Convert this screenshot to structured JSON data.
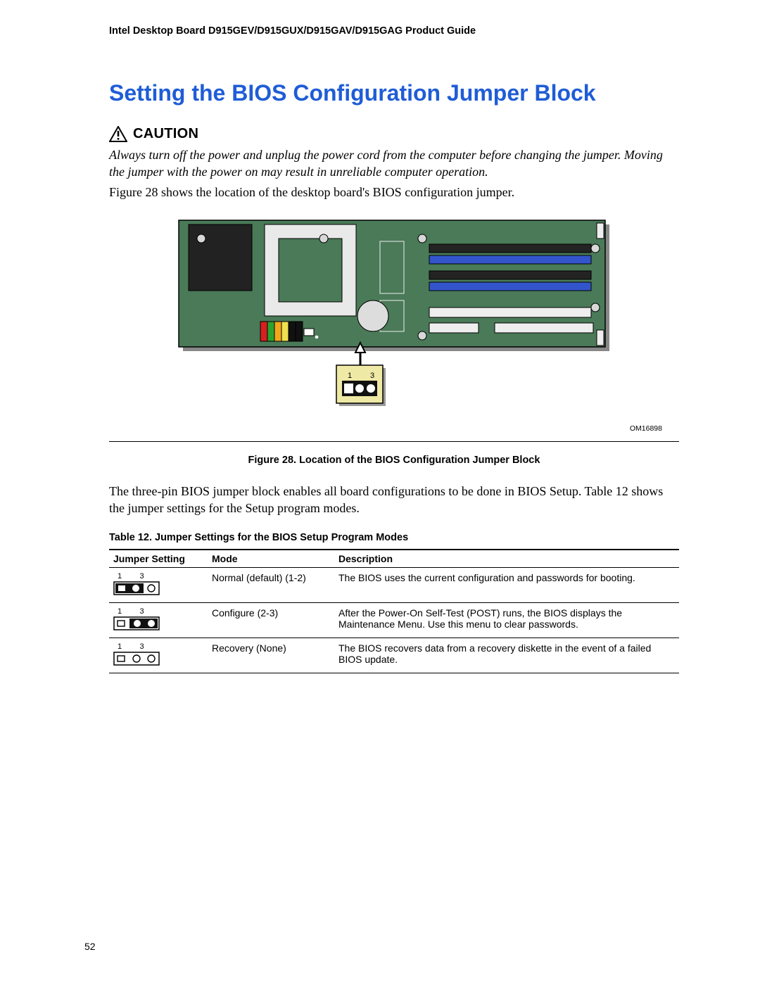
{
  "header": "Intel Desktop Board D915GEV/D915GUX/D915GAV/D915GAG Product Guide",
  "title": "Setting the BIOS Configuration Jumper Block",
  "caution_label": "CAUTION",
  "caution_text": "Always turn off the power and unplug the power cord from the computer before changing the jumper.  Moving the jumper with the power on may result in unreliable computer operation.",
  "intro_text": "Figure 28 shows the location of the desktop board's BIOS configuration jumper.",
  "figure": {
    "callout_pins": {
      "left": "1",
      "right": "3"
    },
    "om_label": "OM16898",
    "caption": "Figure 28.  Location of the BIOS Configuration Jumper Block"
  },
  "after_figure_p1": "The three-pin BIOS jumper block enables all board configurations to be done in BIOS Setup.  Table 12 shows the jumper settings for the Setup program modes.",
  "table": {
    "caption": "Table 12.    Jumper Settings for the BIOS Setup Program Modes",
    "headers": {
      "jumper": "Jumper Setting",
      "mode": "Mode",
      "desc": "Description"
    },
    "rows": [
      {
        "pin_left": "1",
        "pin_right": "3",
        "mode": "Normal (default) (1-2)",
        "desc": "The BIOS uses the current configuration and passwords for booting."
      },
      {
        "pin_left": "1",
        "pin_right": "3",
        "mode": "Configure (2-3)",
        "desc": "After the Power-On Self-Test (POST) runs, the BIOS displays the Maintenance Menu.  Use this menu to clear passwords."
      },
      {
        "pin_left": "1",
        "pin_right": "3",
        "mode": "Recovery (None)",
        "desc": "The BIOS recovers data from a recovery diskette in the event of a failed BIOS update."
      }
    ]
  },
  "page_number": "52"
}
